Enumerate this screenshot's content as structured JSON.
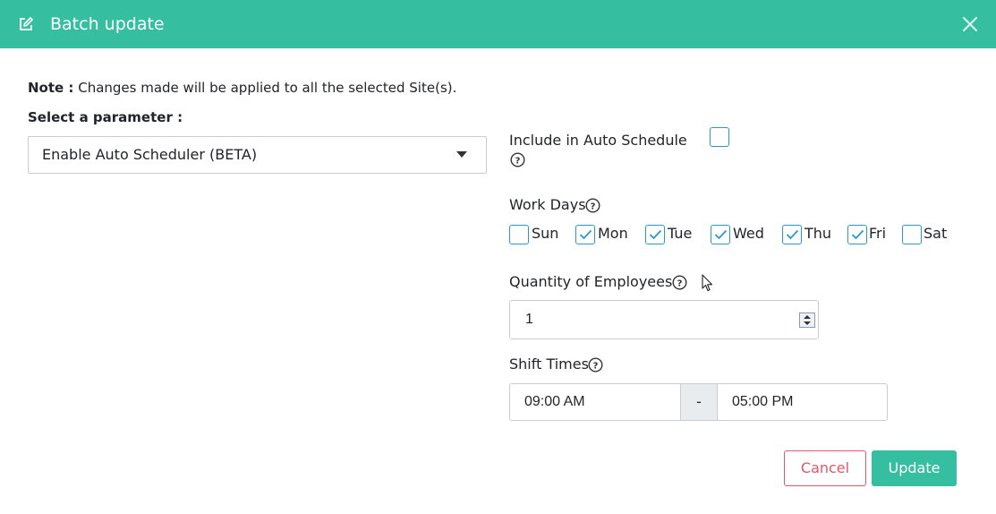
{
  "header": {
    "title": "Batch update",
    "icon": "edit-icon",
    "close_icon": "close-icon",
    "color": "#35bfa0"
  },
  "note": {
    "label": "Note :",
    "text": "Changes made will be applied to all the selected Site(s)."
  },
  "parameter": {
    "label": "Select a parameter :",
    "selected": "Enable Auto Scheduler (BETA)"
  },
  "auto_schedule": {
    "label": "Include in Auto Schedule",
    "checked": false
  },
  "work_days": {
    "label": "Work Days",
    "days": [
      {
        "label": "Sun",
        "checked": false
      },
      {
        "label": "Mon",
        "checked": true
      },
      {
        "label": "Tue",
        "checked": true
      },
      {
        "label": "Wed",
        "checked": true
      },
      {
        "label": "Thu",
        "checked": true
      },
      {
        "label": "Fri",
        "checked": true
      },
      {
        "label": "Sat",
        "checked": false
      }
    ]
  },
  "quantity": {
    "label": "Quantity of Employees",
    "value": "1"
  },
  "shift_times": {
    "label": "Shift Times",
    "start": "09:00 AM",
    "separator": "-",
    "end": "05:00 PM"
  },
  "actions": {
    "cancel_label": "Cancel",
    "update_label": "Update",
    "cancel_color": "#e0566b",
    "update_color": "#35bfa0"
  }
}
